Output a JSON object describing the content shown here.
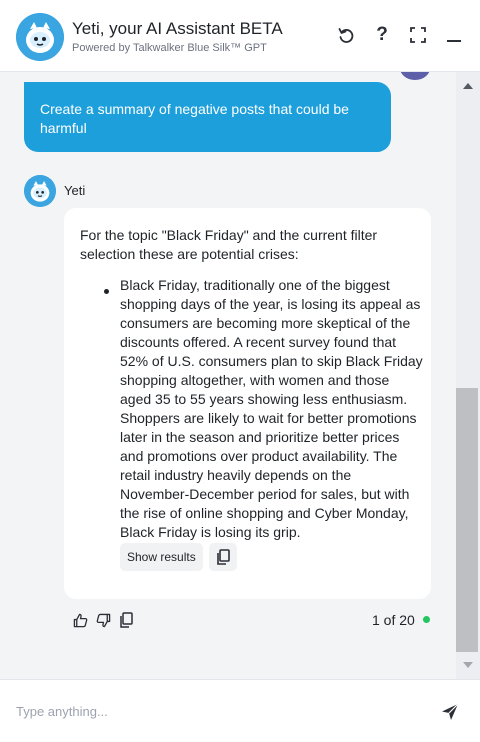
{
  "header": {
    "title": "Yeti, your AI Assistant BETA",
    "subtitle": "Powered by Talkwalker Blue Silk™ GPT",
    "brand_color": "#3aa5e0",
    "icons": [
      "yeti-avatar-icon",
      "reset-icon",
      "help-icon",
      "expand-icon",
      "minimize-icon"
    ]
  },
  "conversation": {
    "user_message": "Create a summary of negative posts that could be harmful",
    "user_bubble_color": "#1d9fdc",
    "bot_name": "Yeti",
    "bot_intro": "For the topic \"Black Friday\" and the current filter selection these are potential crises:",
    "bullets": [
      "Black Friday, traditionally one of the biggest shopping days of the year, is losing its appeal as consumers are becoming more skeptical of the discounts offered. A recent survey found that 52% of U.S. consumers plan to skip Black Friday shopping altogether, with women and those aged 35 to 55 years showing less enthusiasm. Shoppers are likely to wait for better promotions later in the season and prioritize better prices and promotions over product availability. The retail industry heavily depends on the November-December period for sales, but with the rise of online shopping and Cyber Monday, Black Friday is losing its grip."
    ],
    "show_results_label": "Show results",
    "pager": "1 of 20",
    "status_color": "#22c55e",
    "feedback_icons": [
      "thumbs-up-icon",
      "thumbs-down-icon",
      "copy-icon"
    ]
  },
  "composer": {
    "placeholder": "Type anything...",
    "value": ""
  }
}
